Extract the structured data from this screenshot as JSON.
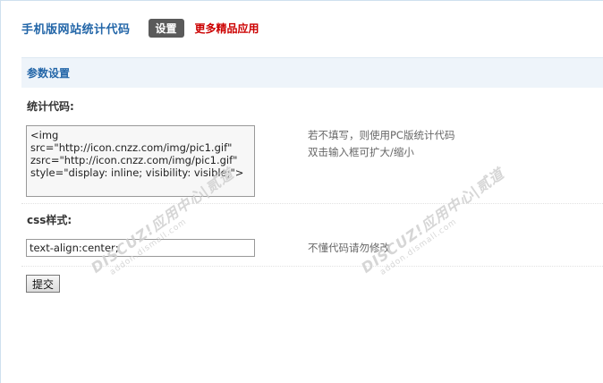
{
  "header": {
    "title": "手机版网站统计代码",
    "settings_button": "设置",
    "more_link": "更多精品应用"
  },
  "section": {
    "title": "参数设置"
  },
  "fields": {
    "stat_code": {
      "label": "统计代码:",
      "value": "<img src=\"http://icon.cnzz.com/img/pic1.gif\" zsrc=\"http://icon.cnzz.com/img/pic1.gif\" style=\"display: inline; visibility: visible;\">",
      "hint_line1": "若不填写，则使用PC版统计代码",
      "hint_line2": "双击输入框可扩大/缩小"
    },
    "css_style": {
      "label": "css样式:",
      "value": "text-align:center;",
      "hint": "不懂代码请勿修改"
    }
  },
  "submit_label": "提交",
  "watermark": {
    "brand": "DISCUZ!应用中心|贰道",
    "domain": "addon.dismall.com"
  },
  "colors": {
    "title_blue": "#2366a8",
    "link_red": "#cc0000",
    "section_bg": "#eef4fa"
  }
}
